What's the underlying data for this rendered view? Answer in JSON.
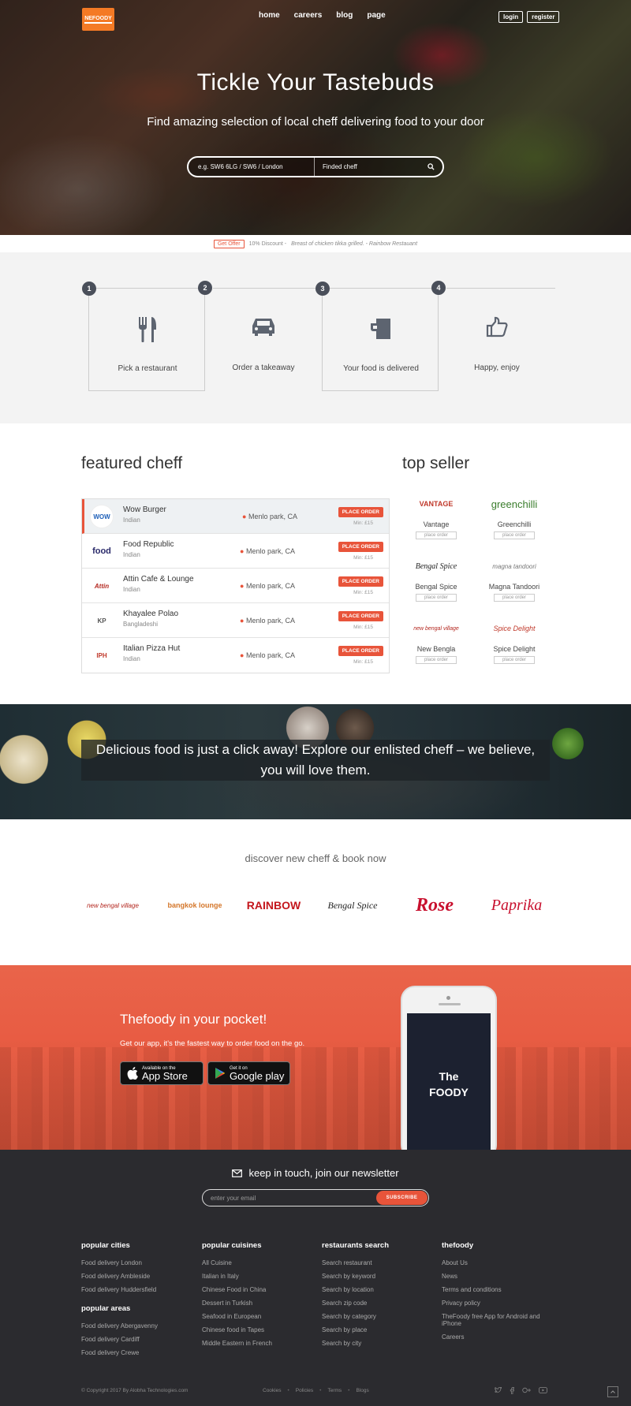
{
  "header": {
    "logo_text": "NEFOODY",
    "nav": [
      "home",
      "careers",
      "blog",
      "page"
    ],
    "login": "login",
    "register": "register"
  },
  "hero": {
    "title": "Tickle Your Tastebuds",
    "subtitle": "Find amazing selection of local cheff delivering food to your door",
    "postcode_placeholder": "e.g. SW6 6LG / SW6 / London",
    "chef_placeholder": "Finded cheff"
  },
  "offer": {
    "badge": "Get Offer",
    "text": "10% Discount -",
    "italic": "Breast of chicken tikka grilled. - Rainbow Restauant"
  },
  "steps": [
    {
      "num": "1",
      "label": "Pick a restaurant",
      "icon": "cutlery-icon"
    },
    {
      "num": "2",
      "label": "Order a takeaway",
      "icon": "car-icon"
    },
    {
      "num": "3",
      "label": "Your food is delivered",
      "icon": "mug-icon"
    },
    {
      "num": "4",
      "label": "Happy, enjoy",
      "icon": "thumbs-up-icon"
    }
  ],
  "featured": {
    "title": "featured cheff",
    "place_order": "PLACE ORDER",
    "min": "Min: £15",
    "items": [
      {
        "name": "Wow Burger",
        "cuisine": "Indian",
        "location": "Menlo park, CA",
        "logo": "WOW",
        "logo_color": "#1d5fb8"
      },
      {
        "name": "Food Republic",
        "cuisine": "Indian",
        "location": "Menlo park, CA",
        "logo": "food",
        "logo_color": "#2a2a6a"
      },
      {
        "name": "Attin Cafe & Lounge",
        "cuisine": "Indian",
        "location": "Menlo park, CA",
        "logo": "Attin",
        "logo_color": "#b3261e"
      },
      {
        "name": "Khayalee Polao",
        "cuisine": "Bangladeshi",
        "location": "Menlo park, CA",
        "logo": "KP",
        "logo_color": "#555555"
      },
      {
        "name": "Italian Pizza Hut",
        "cuisine": "Indian",
        "location": "Menlo park, CA",
        "logo": "IPH",
        "logo_color": "#c0392b"
      }
    ]
  },
  "top_seller": {
    "title": "top seller",
    "button": "place order",
    "items": [
      {
        "name": "Vantage",
        "logo": "VANTAGE",
        "color": "#c0392b"
      },
      {
        "name": "Greenchilli",
        "logo": "greenchilli",
        "color": "#3a7d2c"
      },
      {
        "name": "Bengal Spice",
        "logo": "Bengal Spice",
        "color": "#222222"
      },
      {
        "name": "Magna Tandoori",
        "logo": "magna tandoori",
        "color": "#777777"
      },
      {
        "name": "New Bengla",
        "logo": "new bengal village",
        "color": "#b3261e"
      },
      {
        "name": "Spice Delight",
        "logo": "Spice Delight",
        "color": "#c0392b"
      }
    ]
  },
  "banner": {
    "text": "Delicious food is just a click away! Explore our enlisted cheff – we believe, you will love them."
  },
  "discover": {
    "title": "discover new cheff & book now",
    "partners": [
      {
        "name": "new bengal village",
        "color": "#b3261e"
      },
      {
        "name": "bangkok lounge",
        "color": "#d4762a"
      },
      {
        "name": "RAINBOW",
        "color": "#c4161c"
      },
      {
        "name": "Bengal Spice",
        "color": "#222222"
      },
      {
        "name": "Rose",
        "color": "#c8102e"
      },
      {
        "name": "Paprika",
        "color": "#c8102e"
      }
    ]
  },
  "app": {
    "title": "Thefoody in your pocket!",
    "desc": "Get our app, it's the fastest way to order food on the go.",
    "appstore_small": "Available on the",
    "appstore_big": "App Store",
    "gplay_small": "Get it on",
    "gplay_big": "Google play",
    "phone_line1": "The",
    "phone_line2": "FOODY"
  },
  "footer": {
    "newsletter_title": "keep in touch, join our newsletter",
    "email_placeholder": "enter your email",
    "subscribe": "SUBSCRIBE",
    "columns": [
      {
        "title": "popular cities",
        "links": [
          "Food delivery London",
          "Food delivery Ambleside",
          "Food delivery Huddersfield"
        ],
        "title2": "popular areas",
        "links2": [
          "Food delivery Abergavenny",
          "Food delivery Cardiff",
          "Food delivery Crewe"
        ]
      },
      {
        "title": "popular cuisines",
        "links": [
          "All Cuisine",
          "Italian in Italy",
          "Chinese Food in China",
          "Dessert in Turkish",
          "Seafood in European",
          "Chinese food in Tapes",
          "Middle Eastern in French"
        ]
      },
      {
        "title": "restaurants search",
        "links": [
          "Search restaurant",
          "Search by keyword",
          "Search by location",
          "Search zip code",
          "Search by category",
          "Search by place",
          "Search by city"
        ]
      },
      {
        "title": "thefoody",
        "links": [
          "About Us",
          "News",
          "Terms and conditions",
          "Privacy policy",
          "TheFoody free App for Android and iPhone",
          "Careers"
        ]
      }
    ],
    "copyright": "© Copyright 2017 By Alobha Technologies.com",
    "bottom_links": [
      "Cookies",
      "Policies",
      "Terms",
      "Blogs"
    ],
    "social": [
      "twitter-icon",
      "facebook-icon",
      "google-plus-icon",
      "youtube-icon"
    ]
  },
  "colors": {
    "accent": "#e8543a",
    "footer_bg": "#2b2b2f",
    "logo_bg": "#f47a25"
  }
}
